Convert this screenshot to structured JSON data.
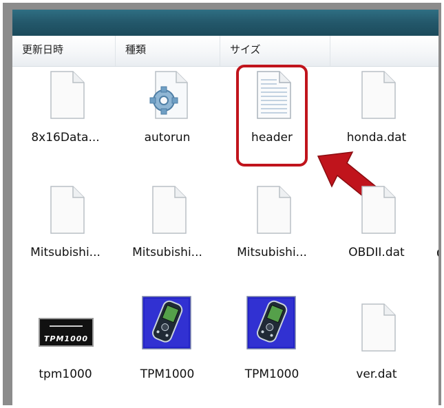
{
  "columns": {
    "modified": "更新日時",
    "type": "種類",
    "size": "サイズ"
  },
  "files": [
    {
      "label": "8x16Data...",
      "icon": "blank-document-icon"
    },
    {
      "label": "autorun",
      "icon": "settings-file-icon"
    },
    {
      "label": "header",
      "icon": "text-document-icon"
    },
    {
      "label": "honda.dat",
      "icon": "blank-document-icon"
    },
    {
      "label": "Mitsubishi...",
      "icon": "blank-document-icon"
    },
    {
      "label": "Mitsubishi...",
      "icon": "blank-document-icon"
    },
    {
      "label": "Mitsubishi...",
      "icon": "blank-document-icon"
    },
    {
      "label": "OBDII.dat",
      "icon": "blank-document-icon"
    },
    {
      "label": "tpm1000",
      "icon": "tpm1000-logo-icon",
      "logo_text": "TPM1000"
    },
    {
      "label": "TPM1000",
      "icon": "handheld-device-icon"
    },
    {
      "label": "TPM1000",
      "icon": "handheld-device-icon"
    },
    {
      "label": "ver.dat",
      "icon": "blank-document-icon"
    }
  ],
  "stray_label": "C",
  "colors": {
    "highlight": "#c0141c",
    "titlebar": "#24596c"
  }
}
